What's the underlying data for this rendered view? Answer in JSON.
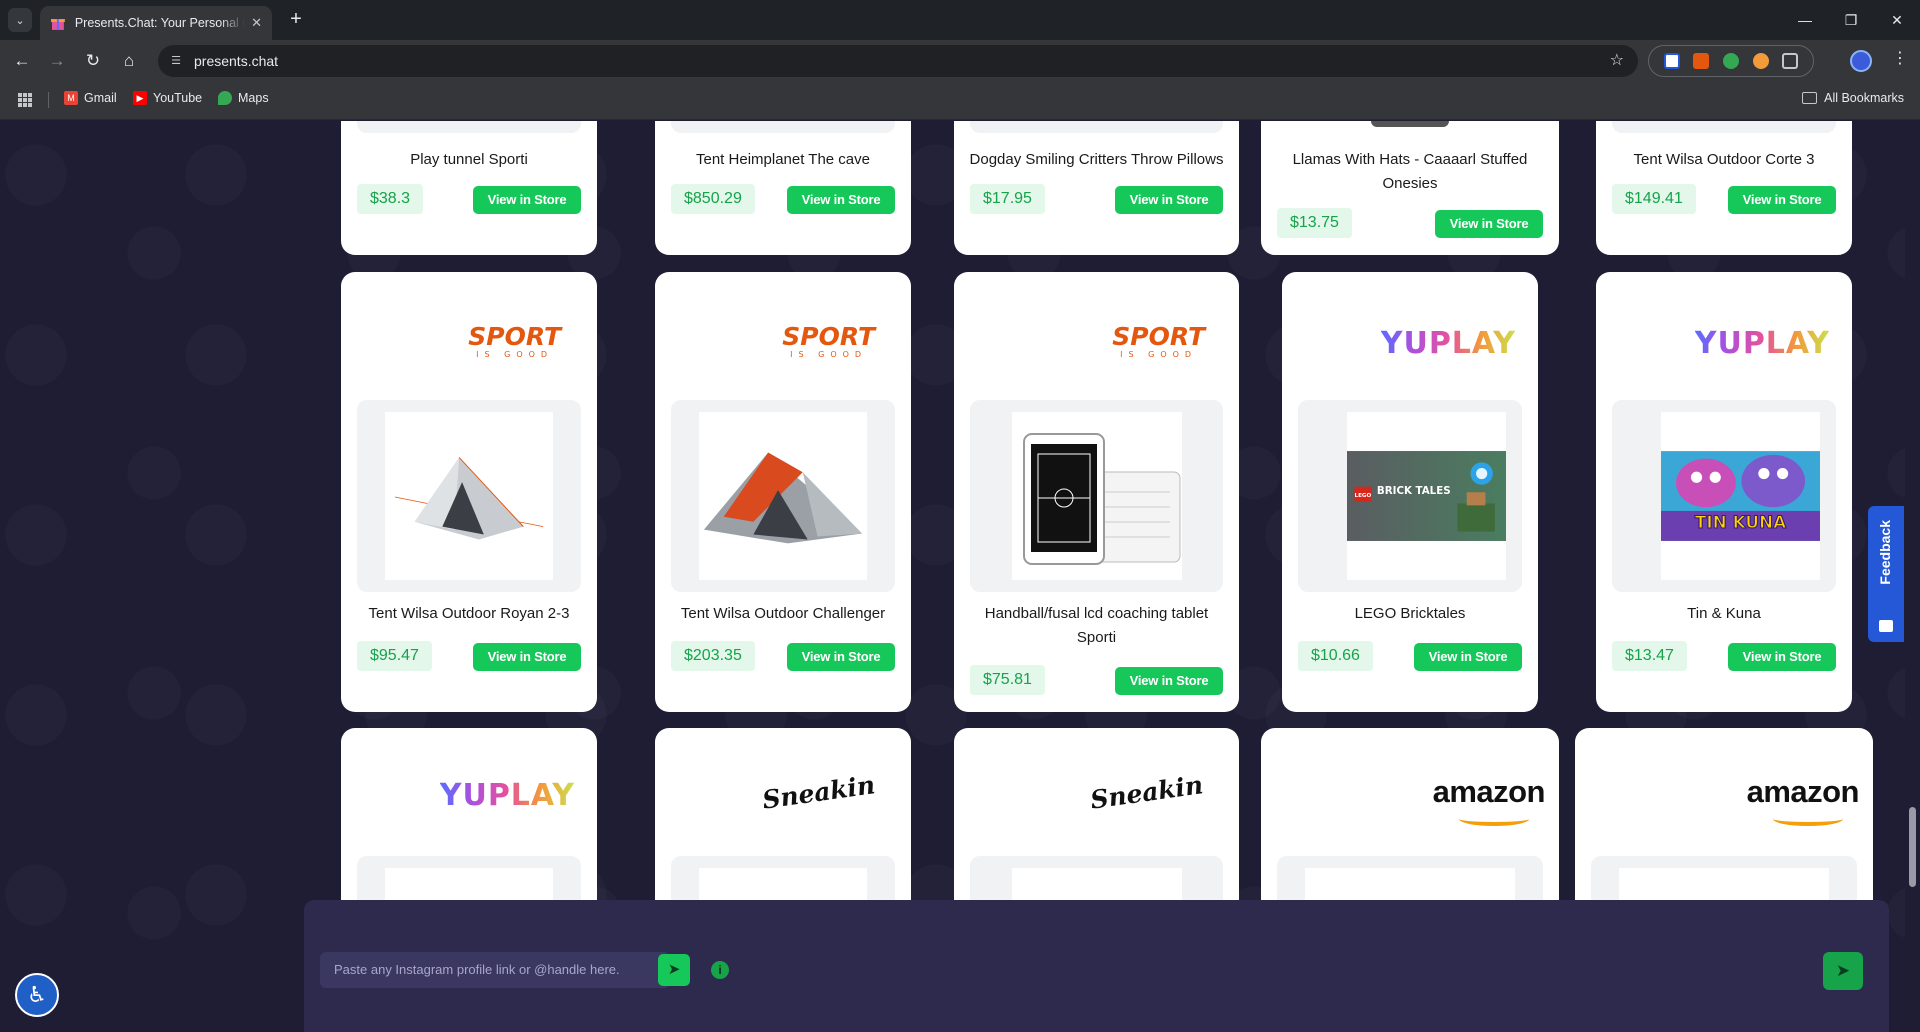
{
  "browser": {
    "tab_title": "Presents.Chat: Your Personal Gift",
    "url": "presents.chat",
    "bookmarks": [
      {
        "label": "Gmail",
        "icon": "gmail-icon",
        "color": "#ea4335"
      },
      {
        "label": "YouTube",
        "icon": "youtube-icon",
        "color": "#ff0000"
      },
      {
        "label": "Maps",
        "icon": "maps-icon",
        "color": "#34a853"
      }
    ],
    "all_bookmarks": "All Bookmarks"
  },
  "products_row1": [
    {
      "title": "Play tunnel Sporti",
      "price": "$38.3",
      "button": "View in Store"
    },
    {
      "title": "Tent Heimplanet The cave",
      "price": "$850.29",
      "button": "View in Store"
    },
    {
      "title": "Dogday Smiling Critters Throw Pillows",
      "price": "$17.95",
      "button": "View in Store"
    },
    {
      "title": "Llamas With Hats - Caaaarl Stuffed Onesies",
      "price": "$13.75",
      "button": "View in Store"
    },
    {
      "title": "Tent Wilsa Outdoor Corte 3",
      "price": "$149.41",
      "button": "View in Store"
    }
  ],
  "products_row2": [
    {
      "title": "Tent Wilsa Outdoor Royan 2-3",
      "price": "$95.47",
      "button": "View in Store",
      "brand": "sport-is-good"
    },
    {
      "title": "Tent Wilsa Outdoor Challenger",
      "price": "$203.35",
      "button": "View in Store",
      "brand": "sport-is-good"
    },
    {
      "title": "Handball/fusal lcd coaching tablet Sporti",
      "price": "$75.81",
      "button": "View in Store",
      "brand": "sport-is-good"
    },
    {
      "title": "LEGO Bricktales",
      "price": "$10.66",
      "button": "View in Store",
      "brand": "yuplay"
    },
    {
      "title": "Tin & Kuna",
      "price": "$13.47",
      "button": "View in Store",
      "brand": "yuplay"
    }
  ],
  "brands": {
    "sport_big": "SPORT",
    "sport_small": "IS GOOD",
    "yuplay": "YUPLAY",
    "sneakin": "Sneakin",
    "amazon": "amazon"
  },
  "image_texts": {
    "lego_logo": "LEGO",
    "bricktales": "BRICK TALES",
    "tinkuna": "TIN KUNA"
  },
  "chat": {
    "placeholder": "Paste any Instagram profile link or @handle here."
  },
  "feedback_label": "Feedback",
  "colors": {
    "accent_green": "#16c75a",
    "price_green": "#16a34a",
    "page_bg": "#1f1d33",
    "chat_bg": "#2d2a4d",
    "sport_orange": "#e4570f",
    "feedback_blue": "#2458d6"
  }
}
